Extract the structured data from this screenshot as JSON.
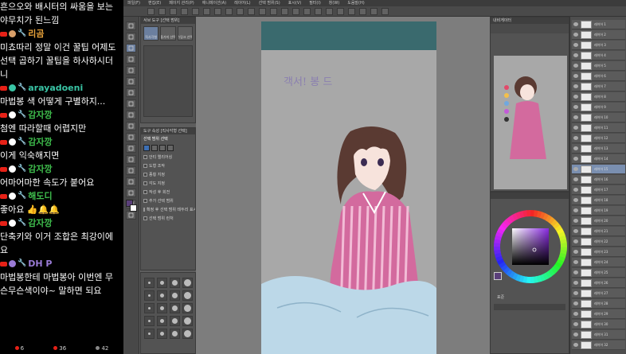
{
  "chat": {
    "messages": [
      {
        "user": "",
        "text": "흔으오와 배시터의 싸움을 보는",
        "userColor": "",
        "badgeColor": ""
      },
      {
        "user": "",
        "text": "야무치가 된느낌",
        "userColor": "",
        "badgeColor": ""
      },
      {
        "user": "리곰",
        "text": "미쵸따리 정말 이건 꿀팁 어제도",
        "userColor": "#e8a23a",
        "badgeColor": "#d9a06a"
      },
      {
        "user": "",
        "text": "선택 곱하기 꿀팁을 하사하시더",
        "userColor": "",
        "badgeColor": ""
      },
      {
        "user": "",
        "text": "니",
        "userColor": "",
        "badgeColor": ""
      },
      {
        "user": "arayadoeni",
        "text": "마법봉 색 어떻게 구별하지...",
        "userColor": "#39c4a5",
        "badgeColor": "#39c4a5"
      },
      {
        "user": "감자깡",
        "text": "첨엔 따라할때 어렵지만",
        "userColor": "#3fbf4d",
        "badgeColor": "#ffffff"
      },
      {
        "user": "감자깡",
        "text": "이게 익숙해지면",
        "userColor": "#3fbf4d",
        "badgeColor": "#ffffff"
      },
      {
        "user": "감자깡",
        "text": "어마어마한 속도가 붙어요",
        "userColor": "#3fbf4d",
        "badgeColor": "#ffffff"
      },
      {
        "user": "해도디",
        "text": "좋아요 👍🔔🔔",
        "userColor": "#3fbf4d",
        "badgeColor": "#ffffff"
      },
      {
        "user": "감자깡",
        "text": "단축키와 이거 조합은 최강이에",
        "userColor": "#3fbf4d",
        "badgeColor": "#ffffff"
      },
      {
        "user": "",
        "text": "요",
        "userColor": "",
        "badgeColor": ""
      },
      {
        "user": "DH P",
        "text": "마법봉한테 마법봉아 이번엔 무",
        "userColor": "#9a7bd6",
        "badgeColor": "#9a7bd6"
      },
      {
        "user": "",
        "text": "슨무슨색이야~ 말하면 되요",
        "userColor": "",
        "badgeColor": ""
      }
    ],
    "footer": {
      "count_a": "6",
      "count_b": "36",
      "count_c": "42"
    }
  },
  "app": {
    "menu": [
      "파일(F)",
      "편집(E)",
      "페이지 관리(P)",
      "애니메이션(A)",
      "레이어(L)",
      "선택 범위(S)",
      "표시(V)",
      "필터(I)",
      "창(W)",
      "도움말(H)"
    ],
    "sub_tool_title": "서브 도구 [선택 범위]",
    "sub_tool_tabs": [
      "직사각형",
      "올가미 선택",
      "슈링크 선택"
    ],
    "tool_property_title": "도구 속성 [직사각형 선택]",
    "tool_property_name": "선택 범위 선택",
    "properties": [
      {
        "label": "안티 앨리어싱",
        "value": 0.5
      },
      {
        "label": "도형 조작",
        "value": 0.0
      },
      {
        "label": "종횡 지정",
        "value": 0.3
      },
      {
        "label": "각도 지정",
        "value": 0.0
      },
      {
        "label": "작성 후 회전",
        "value": 0.0
      },
      {
        "label": "추가 선택 범위",
        "value": 0.0
      },
      {
        "label": "확정 후 선택 범위 테두리 표시",
        "value": 0.0
      },
      {
        "label": "선택 범위 런처",
        "value": 0.0
      }
    ],
    "navigator_title": "내비게이터",
    "layer_rows": [
      "레이어 1",
      "레이어 2",
      "레이어 3",
      "레이어 4",
      "레이어 5",
      "레이어 6",
      "레이어 7",
      "레이어 8",
      "레이어 9",
      "레이어 10",
      "레이어 11",
      "레이어 12",
      "레이어 13",
      "레이어 14",
      "레이어 15",
      "레이어 16",
      "레이어 17",
      "레이어 18",
      "레이어 19",
      "레이어 20",
      "레이어 21",
      "레이어 22",
      "레이어 23",
      "레이어 24",
      "레이어 25",
      "레이어 26",
      "레이어 27",
      "레이어 28",
      "레이어 29",
      "레이어 30",
      "레이어 31",
      "레이어 32"
    ],
    "color_mode_label": "표준"
  },
  "canvas": {
    "handwriting": "객서! 봉 드",
    "colors": {
      "header": "#3a6a6e",
      "background": "#a8a8a8",
      "pajama_pink": "#d36a9e",
      "pajama_stripe": "#f2bcd6",
      "hair": "#5a3a32",
      "skin": "#f7e3dc",
      "blanket": "#bcd8e8"
    }
  }
}
